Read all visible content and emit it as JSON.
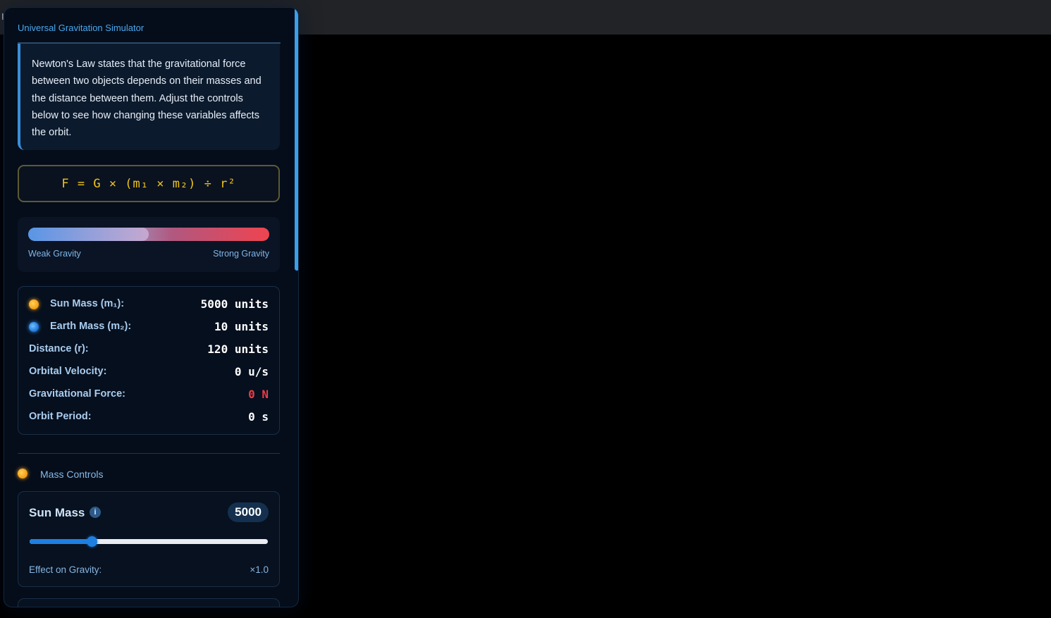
{
  "window": {
    "corner_glyph": "I"
  },
  "panel": {
    "title": "Universal Gravitation Simulator",
    "intro": "Newton's Law states that the gravitational force between two objects depends on their masses and the distance between them. Adjust the controls below to see how changing these variables affects the orbit.",
    "formula": "F = G × (m₁ × m₂) ÷ r²",
    "gravity_meter": {
      "level_fraction": 0.5,
      "weak_label": "Weak Gravity",
      "strong_label": "Strong Gravity"
    },
    "stats": [
      {
        "label": "Sun Mass (m₁):",
        "value": "5000 units",
        "icon": "sun-dot-icon"
      },
      {
        "label": "Earth Mass (m₂):",
        "value": "10 units",
        "icon": "earth-dot-icon"
      },
      {
        "label": "Distance (r):",
        "value": "120 units"
      },
      {
        "label": "Orbital Velocity:",
        "value": "0 u/s"
      },
      {
        "label": "Gravitational Force:",
        "value": "0 N",
        "color": "#ee3a46"
      },
      {
        "label": "Orbit Period:",
        "value": "0 s"
      }
    ],
    "mass_section": {
      "title": "Mass Controls",
      "sun_control": {
        "label": "Sun Mass",
        "info_glyph": "i",
        "value": "5000",
        "slider_fraction": 0.26,
        "effect_label": "Effect on Gravity:",
        "effect_value": "×1.0"
      }
    }
  },
  "colors": {
    "accent": "#3aa0e9",
    "formula": "#f0c419",
    "sun": "#f79a0d",
    "earth": "#1c70d6",
    "force": "#ee3a46"
  }
}
